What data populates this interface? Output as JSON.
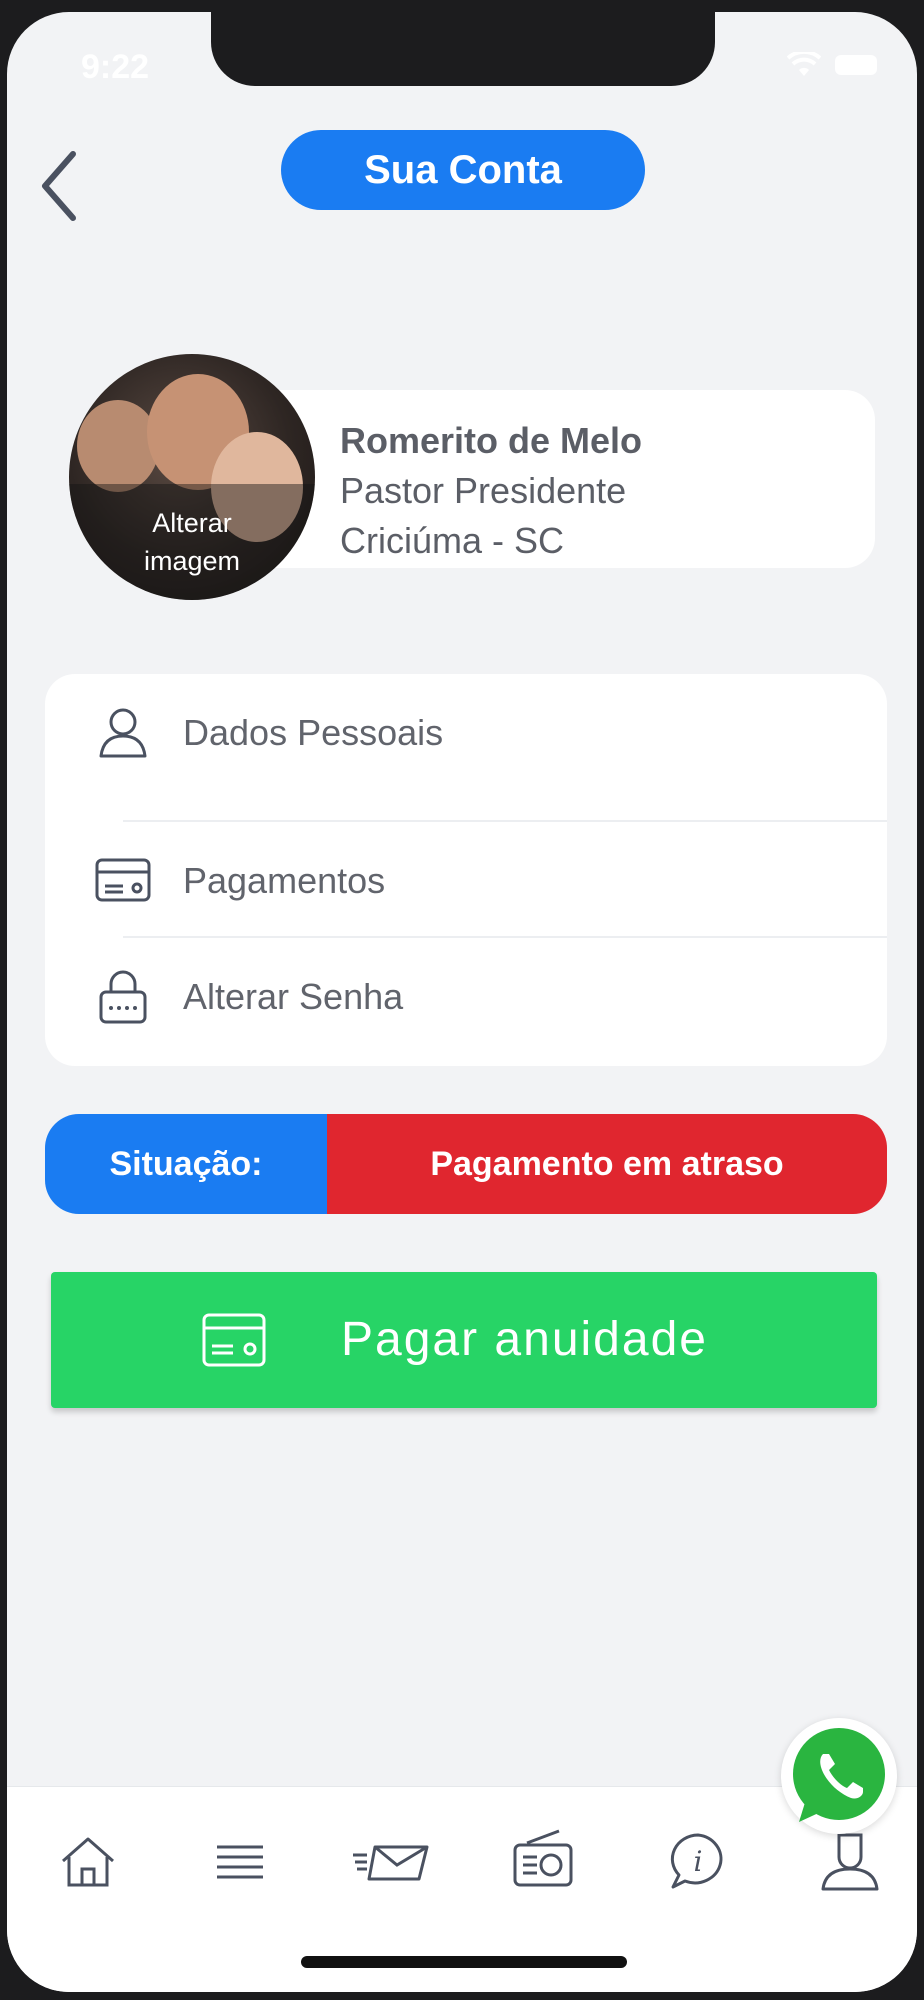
{
  "status_bar": {
    "time": "9:22"
  },
  "header": {
    "title": "Sua Conta"
  },
  "profile": {
    "name": "Romerito de Melo",
    "role": "Pastor Presidente",
    "location": "Criciúma - SC",
    "avatar_action_line1": "Alterar",
    "avatar_action_line2": "imagem"
  },
  "menu": {
    "items": [
      {
        "label": "Dados Pessoais",
        "icon": "user-icon"
      },
      {
        "label": "Pagamentos",
        "icon": "credit-card-icon"
      },
      {
        "label": "Alterar Senha",
        "icon": "lock-icon"
      }
    ]
  },
  "situation": {
    "label": "Situação:",
    "value": "Pagamento em atraso"
  },
  "pay_button": {
    "label": "Pagar anuidade",
    "icon": "credit-card-icon"
  },
  "tabs": [
    {
      "icon": "home-icon"
    },
    {
      "icon": "list-icon"
    },
    {
      "icon": "mail-icon"
    },
    {
      "icon": "radio-icon"
    },
    {
      "icon": "info-icon"
    },
    {
      "icon": "user-icon"
    }
  ],
  "colors": {
    "primary_blue": "#1a7cf2",
    "alert_red": "#e0262f",
    "pay_green": "#27d466",
    "background": "#f2f3f5"
  }
}
